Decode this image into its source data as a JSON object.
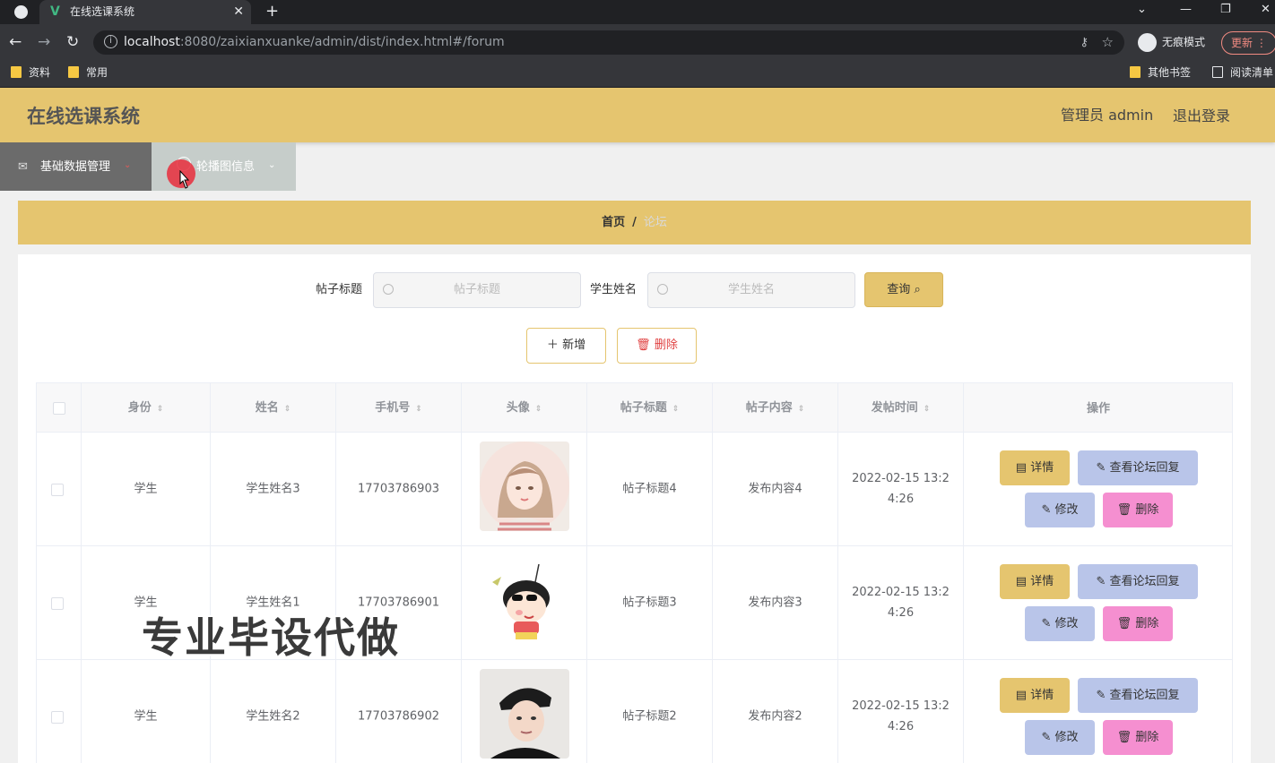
{
  "browser": {
    "tab_title": "在线选课系统",
    "url_host": "localhost",
    "url_rest": ":8080/zaixianxuanke/admin/dist/index.html#/forum",
    "incognito_label": "无痕模式",
    "update_label": "更新",
    "bookmarks": [
      "资料",
      "常用"
    ],
    "other_bookmarks": "其他书签",
    "reading_list": "阅读清单"
  },
  "header": {
    "brand": "在线选课系统",
    "user": "管理员 admin",
    "logout": "退出登录"
  },
  "menu": {
    "item1": "基础数据管理",
    "item2": "轮播图信息"
  },
  "breadcrumb": {
    "home": "首页",
    "sep": "/",
    "current": "论坛"
  },
  "search": {
    "title_label": "帖子标题",
    "title_placeholder": "帖子标题",
    "name_label": "学生姓名",
    "name_placeholder": "学生姓名",
    "query_label": "查询"
  },
  "actions": {
    "add_label": "新增",
    "delete_label": "删除"
  },
  "table": {
    "headers": [
      "身份",
      "姓名",
      "手机号",
      "头像",
      "帖子标题",
      "帖子内容",
      "发帖时间",
      "操作"
    ],
    "rows": [
      {
        "role": "学生",
        "name": "学生姓名3",
        "phone": "17703786903",
        "avatar": "girl",
        "title": "帖子标题4",
        "content": "发布内容4",
        "time_1": "2022-02-15 13:2",
        "time_2": "4:26"
      },
      {
        "role": "学生",
        "name": "学生姓名1",
        "phone": "17703786901",
        "avatar": "cartoon",
        "title": "帖子标题3",
        "content": "发布内容3",
        "time_1": "2022-02-15 13:2",
        "time_2": "4:26"
      },
      {
        "role": "学生",
        "name": "学生姓名2",
        "phone": "17703786902",
        "avatar": "boy",
        "title": "帖子标题2",
        "content": "发布内容2",
        "time_1": "2022-02-15 13:2",
        "time_2": "4:26"
      }
    ],
    "row_buttons": {
      "detail": "详情",
      "replies": "查看论坛回复",
      "edit": "修改",
      "delete": "删除"
    }
  },
  "watermark": "专业毕设代做"
}
